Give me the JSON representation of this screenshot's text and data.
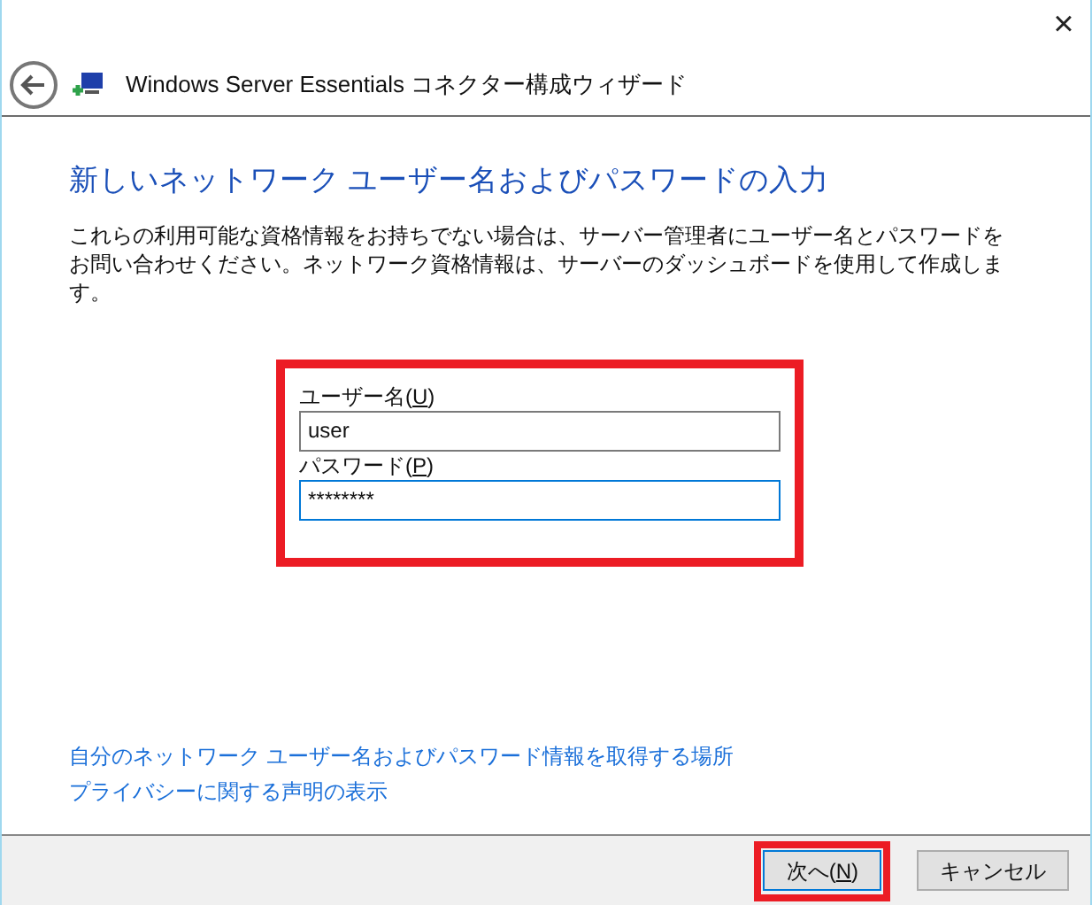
{
  "window": {
    "close": "×",
    "title": "Windows Server Essentials コネクター構成ウィザード"
  },
  "heading": "新しいネットワーク ユーザー名およびパスワードの入力",
  "description": "これらの利用可能な資格情報をお持ちでない場合は、サーバー管理者にユーザー名とパスワードをお問い合わせください。ネットワーク資格情報は、サーバーのダッシュボードを使用して作成します。",
  "form": {
    "highlighted": true,
    "fields": [
      {
        "label_start": "ユーザー名(",
        "access_key": "U",
        "label_end": ")",
        "value": "user",
        "focused": false
      },
      {
        "label_start": "パスワード(",
        "access_key": "P",
        "label_end": ")",
        "value": "********",
        "focused": true
      }
    ]
  },
  "links": [
    "自分のネットワーク ユーザー名およびパスワード情報を取得する場所",
    "プライバシーに関する声明の表示"
  ],
  "buttons": [
    {
      "label_start": "次へ(",
      "access_key": "N",
      "label_end": ")",
      "highlighted": true,
      "default": true
    },
    {
      "label": "キャンセル",
      "highlighted": false,
      "default": false
    }
  ]
}
